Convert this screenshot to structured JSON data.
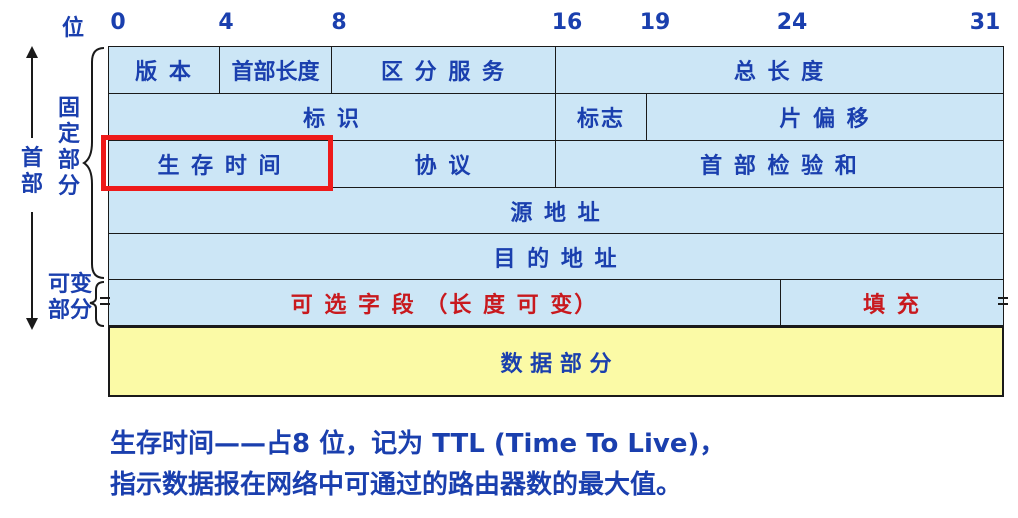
{
  "bit_header": {
    "label": "位",
    "positions": [
      "0",
      "4",
      "8",
      "16",
      "19",
      "24",
      "31"
    ]
  },
  "side_labels": {
    "header": "首部",
    "fixed": "固定部分",
    "variable": "可变部分"
  },
  "fields": {
    "version": "版 本",
    "header_length": "首部长度",
    "diff_services": "区 分 服 务",
    "total_length": "总  长  度",
    "identification": "标     识",
    "flags": "标志",
    "fragment_offset": "片  偏  移",
    "ttl": "生 存 时 间",
    "protocol": "协   议",
    "checksum": "首  部  检  验  和",
    "source_address": "源  地  址",
    "destination_address": "目  的  地  址",
    "options": "可  选  字  段  （长  度  可  变）",
    "padding": "填     充",
    "data": "数        据        部        分"
  },
  "caption": {
    "line1": "生存时间——占8 位，记为 TTL (Time To Live)，",
    "line2": "指示数据报在网络中可通过的路由器数的最大值。"
  },
  "colors": {
    "cell_fill": "#cce6f6",
    "data_fill": "#fbfaa6",
    "text_blue": "#1a3fae",
    "text_red": "#c8191e",
    "highlight": "#ee1a1a"
  }
}
